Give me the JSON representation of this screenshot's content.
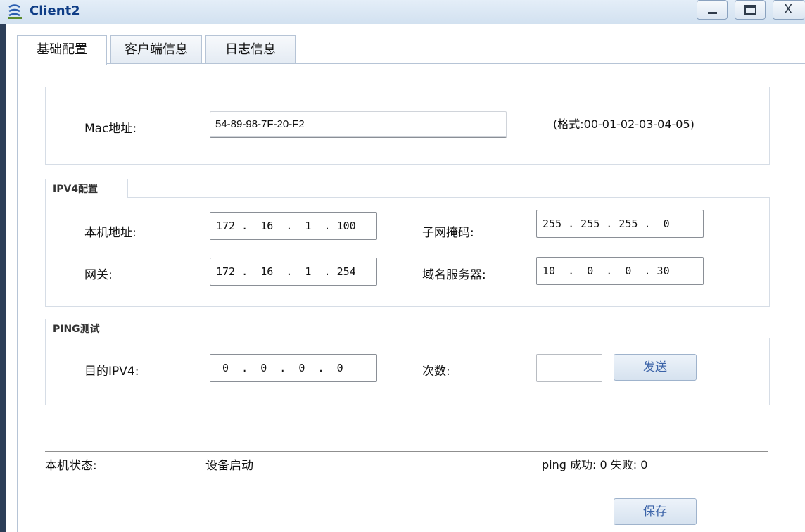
{
  "window": {
    "title": "Client2",
    "controls": [
      "minimize",
      "maximize",
      "close"
    ],
    "close_label": "X"
  },
  "tabs": [
    {
      "label": "基础配置",
      "active": true
    },
    {
      "label": "客户端信息",
      "active": false
    },
    {
      "label": "日志信息",
      "active": false
    }
  ],
  "mac": {
    "label": "Mac地址:",
    "value": "54-89-98-7F-20-F2",
    "format_hint": "(格式:00-01-02-03-04-05)"
  },
  "ipv4": {
    "section_title": "IPV4配置",
    "local_ip_label": "本机地址:",
    "local_ip_value": "172 .  16  .  1  . 100",
    "subnet_label": "子网掩码:",
    "subnet_value": "255 . 255 . 255 .  0",
    "gateway_label": "网关:",
    "gateway_value": "172 .  16  .  1  . 254",
    "dns_label": "域名服务器:",
    "dns_value": "10  .  0  .  0  . 30"
  },
  "ping": {
    "section_title": "PING测试",
    "dest_label": "目的IPV4:",
    "dest_value": " 0  .  0  .  0  .  0",
    "count_label": "次数:",
    "count_value": "",
    "send_button": "发送"
  },
  "status": {
    "label": "本机状态:",
    "value": "设备启动",
    "ping_summary": "ping 成功: 0 失败: 0"
  },
  "save_button": "保存"
}
